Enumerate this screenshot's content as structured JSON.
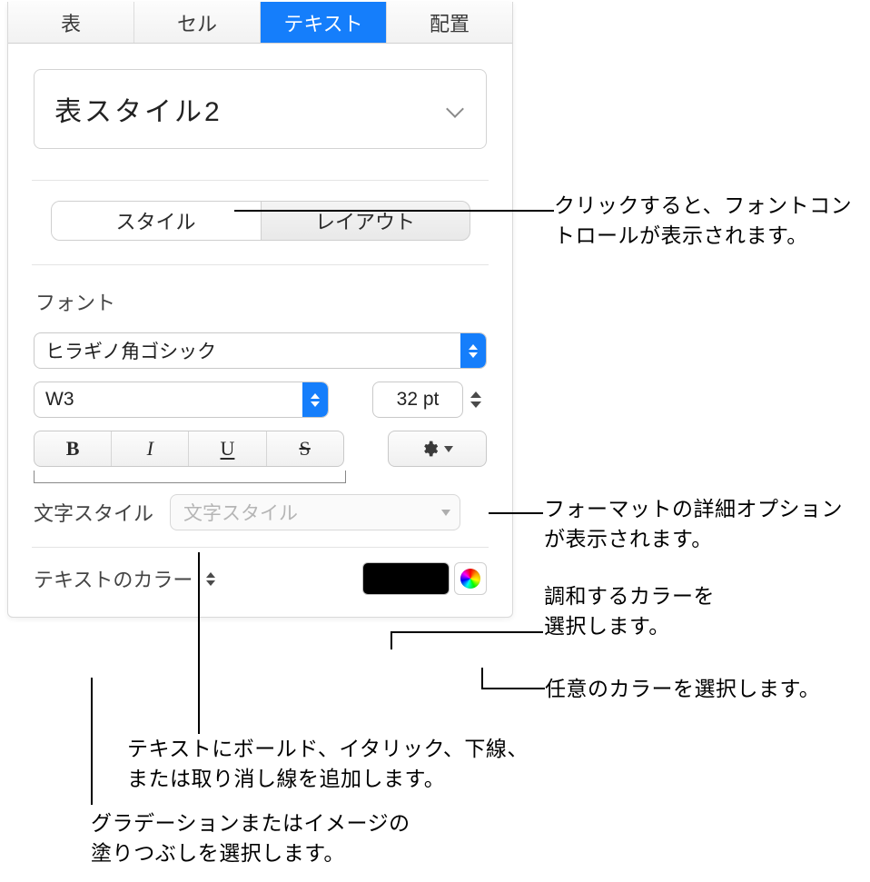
{
  "tabs": {
    "table": "表",
    "cell": "セル",
    "text": "テキスト",
    "arrange": "配置"
  },
  "paragraph_style": {
    "current": "表スタイル2"
  },
  "segment": {
    "style": "スタイル",
    "layout": "レイアウト"
  },
  "font": {
    "heading": "フォント",
    "family": "ヒラギノ角ゴシック",
    "weight": "W3",
    "size": "32 pt"
  },
  "bius": {
    "bold": "B",
    "italic": "I",
    "underline": "U",
    "strike": "S"
  },
  "char_style": {
    "label": "文字スタイル",
    "placeholder": "文字スタイル"
  },
  "text_color": {
    "label": "テキストのカラー",
    "swatch": "#000000"
  },
  "callouts": {
    "style_tab": "クリックすると、フォントコントロールが表示されます。",
    "advanced": "フォーマットの詳細オプションが表示されます。",
    "swatch": "調和するカラーを\n選択します。",
    "wheel": "任意のカラーを選択します。",
    "bius": "テキストにボールド、イタリック、下線、\nまたは取り消し線を追加します。",
    "gradient": "グラデーションまたはイメージの\n塗りつぶしを選択します。"
  }
}
